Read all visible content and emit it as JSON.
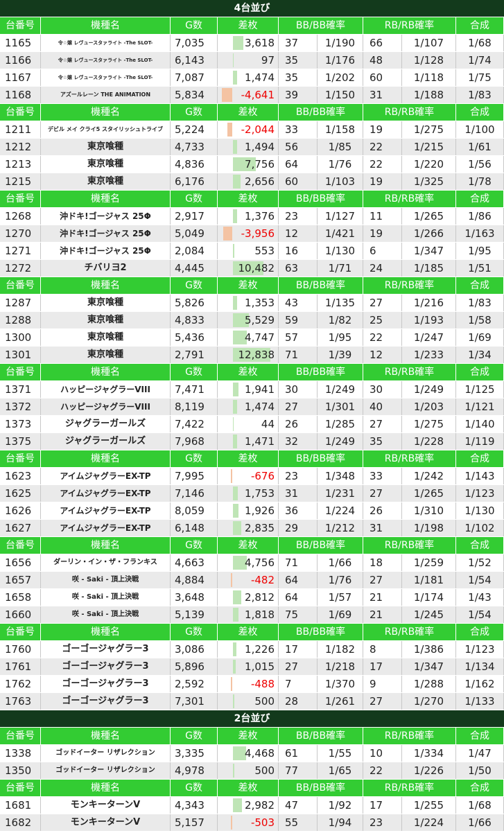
{
  "headers": [
    "台番号",
    "機種名",
    "G数",
    "差枚",
    "BB/BB確率",
    "",
    "RB/RB確率",
    "",
    "合成"
  ],
  "sections": [
    {
      "title": "4台並び",
      "groups": [
        [
          {
            "no": "1165",
            "name": "令☆嬢 レヴュースタァライト -The SLOT-",
            "g": "7,035",
            "diff": 3618,
            "diff_text": "3,618",
            "bb": "37",
            "bbr": "1/190",
            "rb": "66",
            "rbr": "1/107",
            "tot": "1/68"
          },
          {
            "no": "1166",
            "name": "令☆嬢 レヴュースタァライト -The SLOT-",
            "g": "6,143",
            "diff": 97,
            "diff_text": "97",
            "bb": "35",
            "bbr": "1/176",
            "rb": "48",
            "rbr": "1/128",
            "tot": "1/74"
          },
          {
            "no": "1167",
            "name": "令☆嬢 レヴュースタァライト -The SLOT-",
            "g": "7,087",
            "diff": 1474,
            "diff_text": "1,474",
            "bb": "35",
            "bbr": "1/202",
            "rb": "60",
            "rbr": "1/118",
            "tot": "1/75"
          },
          {
            "no": "1168",
            "name": "アズールレーン THE ANIMATION",
            "g": "5,834",
            "diff": -4641,
            "diff_text": "-4,641",
            "bb": "39",
            "bbr": "1/150",
            "rb": "31",
            "rbr": "1/188",
            "tot": "1/83"
          }
        ],
        [
          {
            "no": "1211",
            "name": "デビル メイ クライ5 スタイリッシュトライブ",
            "g": "5,224",
            "diff": -2044,
            "diff_text": "-2,044",
            "bb": "33",
            "bbr": "1/158",
            "rb": "19",
            "rbr": "1/275",
            "tot": "1/100"
          },
          {
            "no": "1212",
            "name": "東京喰種",
            "g": "4,733",
            "diff": 1494,
            "diff_text": "1,494",
            "bb": "56",
            "bbr": "1/85",
            "rb": "22",
            "rbr": "1/215",
            "tot": "1/61"
          },
          {
            "no": "1213",
            "name": "東京喰種",
            "g": "4,836",
            "diff": 7756,
            "diff_text": "7,756",
            "bb": "64",
            "bbr": "1/76",
            "rb": "22",
            "rbr": "1/220",
            "tot": "1/56"
          },
          {
            "no": "1215",
            "name": "東京喰種",
            "g": "6,176",
            "diff": 2656,
            "diff_text": "2,656",
            "bb": "60",
            "bbr": "1/103",
            "rb": "19",
            "rbr": "1/325",
            "tot": "1/78"
          }
        ],
        [
          {
            "no": "1268",
            "name": "沖ドキ!ゴージャス 25Φ",
            "g": "2,917",
            "diff": 1376,
            "diff_text": "1,376",
            "bb": "23",
            "bbr": "1/127",
            "rb": "11",
            "rbr": "1/265",
            "tot": "1/86"
          },
          {
            "no": "1270",
            "name": "沖ドキ!ゴージャス 25Φ",
            "g": "5,049",
            "diff": -3956,
            "diff_text": "-3,956",
            "bb": "12",
            "bbr": "1/421",
            "rb": "19",
            "rbr": "1/266",
            "tot": "1/163"
          },
          {
            "no": "1271",
            "name": "沖ドキ!ゴージャス 25Φ",
            "g": "2,084",
            "diff": 553,
            "diff_text": "553",
            "bb": "16",
            "bbr": "1/130",
            "rb": "6",
            "rbr": "1/347",
            "tot": "1/95"
          },
          {
            "no": "1272",
            "name": "チバリヨ2",
            "g": "4,445",
            "diff": 10482,
            "diff_text": "10,482",
            "bb": "63",
            "bbr": "1/71",
            "rb": "24",
            "rbr": "1/185",
            "tot": "1/51"
          }
        ],
        [
          {
            "no": "1287",
            "name": "東京喰種",
            "g": "5,826",
            "diff": 1353,
            "diff_text": "1,353",
            "bb": "43",
            "bbr": "1/135",
            "rb": "27",
            "rbr": "1/216",
            "tot": "1/83"
          },
          {
            "no": "1288",
            "name": "東京喰種",
            "g": "4,833",
            "diff": 5529,
            "diff_text": "5,529",
            "bb": "59",
            "bbr": "1/82",
            "rb": "25",
            "rbr": "1/193",
            "tot": "1/58"
          },
          {
            "no": "1300",
            "name": "東京喰種",
            "g": "5,436",
            "diff": 4747,
            "diff_text": "4,747",
            "bb": "57",
            "bbr": "1/95",
            "rb": "22",
            "rbr": "1/247",
            "tot": "1/69"
          },
          {
            "no": "1301",
            "name": "東京喰種",
            "g": "2,791",
            "diff": 12838,
            "diff_text": "12,838",
            "bb": "71",
            "bbr": "1/39",
            "rb": "12",
            "rbr": "1/233",
            "tot": "1/34"
          }
        ],
        [
          {
            "no": "1371",
            "name": "ハッピージャグラーVIII",
            "g": "7,471",
            "diff": 1941,
            "diff_text": "1,941",
            "bb": "30",
            "bbr": "1/249",
            "rb": "30",
            "rbr": "1/249",
            "tot": "1/125"
          },
          {
            "no": "1372",
            "name": "ハッピージャグラーVIII",
            "g": "8,119",
            "diff": 1474,
            "diff_text": "1,474",
            "bb": "27",
            "bbr": "1/301",
            "rb": "40",
            "rbr": "1/203",
            "tot": "1/121"
          },
          {
            "no": "1373",
            "name": "ジャグラーガールズ",
            "g": "7,422",
            "diff": 44,
            "diff_text": "44",
            "bb": "26",
            "bbr": "1/285",
            "rb": "27",
            "rbr": "1/275",
            "tot": "1/140"
          },
          {
            "no": "1375",
            "name": "ジャグラーガールズ",
            "g": "7,968",
            "diff": 1471,
            "diff_text": "1,471",
            "bb": "32",
            "bbr": "1/249",
            "rb": "35",
            "rbr": "1/228",
            "tot": "1/119"
          }
        ],
        [
          {
            "no": "1623",
            "name": "アイムジャグラーEX-TP",
            "g": "7,995",
            "diff": -676,
            "diff_text": "-676",
            "bb": "23",
            "bbr": "1/348",
            "rb": "33",
            "rbr": "1/242",
            "tot": "1/143"
          },
          {
            "no": "1625",
            "name": "アイムジャグラーEX-TP",
            "g": "7,146",
            "diff": 1753,
            "diff_text": "1,753",
            "bb": "31",
            "bbr": "1/231",
            "rb": "27",
            "rbr": "1/265",
            "tot": "1/123"
          },
          {
            "no": "1626",
            "name": "アイムジャグラーEX-TP",
            "g": "8,059",
            "diff": 1926,
            "diff_text": "1,926",
            "bb": "36",
            "bbr": "1/224",
            "rb": "26",
            "rbr": "1/310",
            "tot": "1/130"
          },
          {
            "no": "1627",
            "name": "アイムジャグラーEX-TP",
            "g": "6,148",
            "diff": 2835,
            "diff_text": "2,835",
            "bb": "29",
            "bbr": "1/212",
            "rb": "31",
            "rbr": "1/198",
            "tot": "1/102"
          }
        ],
        [
          {
            "no": "1656",
            "name": "ダーリン・イン・ザ・フランキス",
            "g": "4,663",
            "diff": 4756,
            "diff_text": "4,756",
            "bb": "71",
            "bbr": "1/66",
            "rb": "18",
            "rbr": "1/259",
            "tot": "1/52"
          },
          {
            "no": "1657",
            "name": "咲 - Saki - 頂上決戦",
            "g": "4,884",
            "diff": -482,
            "diff_text": "-482",
            "bb": "64",
            "bbr": "1/76",
            "rb": "27",
            "rbr": "1/181",
            "tot": "1/54"
          },
          {
            "no": "1658",
            "name": "咲 - Saki - 頂上決戦",
            "g": "3,648",
            "diff": 2812,
            "diff_text": "2,812",
            "bb": "64",
            "bbr": "1/57",
            "rb": "21",
            "rbr": "1/174",
            "tot": "1/43"
          },
          {
            "no": "1660",
            "name": "咲 - Saki - 頂上決戦",
            "g": "5,139",
            "diff": 1818,
            "diff_text": "1,818",
            "bb": "75",
            "bbr": "1/69",
            "rb": "21",
            "rbr": "1/245",
            "tot": "1/54"
          }
        ],
        [
          {
            "no": "1760",
            "name": "ゴーゴージャグラー3",
            "g": "3,086",
            "diff": 1226,
            "diff_text": "1,226",
            "bb": "17",
            "bbr": "1/182",
            "rb": "8",
            "rbr": "1/386",
            "tot": "1/123"
          },
          {
            "no": "1761",
            "name": "ゴーゴージャグラー3",
            "g": "5,896",
            "diff": 1015,
            "diff_text": "1,015",
            "bb": "27",
            "bbr": "1/218",
            "rb": "17",
            "rbr": "1/347",
            "tot": "1/134"
          },
          {
            "no": "1762",
            "name": "ゴーゴージャグラー3",
            "g": "2,592",
            "diff": -488,
            "diff_text": "-488",
            "bb": "7",
            "bbr": "1/370",
            "rb": "9",
            "rbr": "1/288",
            "tot": "1/162"
          },
          {
            "no": "1763",
            "name": "ゴーゴージャグラー3",
            "g": "7,301",
            "diff": 500,
            "diff_text": "500",
            "bb": "28",
            "bbr": "1/261",
            "rb": "27",
            "rbr": "1/270",
            "tot": "1/133"
          }
        ]
      ]
    },
    {
      "title": "2台並び",
      "groups": [
        [
          {
            "no": "1338",
            "name": "ゴッドイーター リザレクション",
            "g": "3,335",
            "diff": 4468,
            "diff_text": "4,468",
            "bb": "61",
            "bbr": "1/55",
            "rb": "10",
            "rbr": "1/334",
            "tot": "1/47"
          },
          {
            "no": "1350",
            "name": "ゴッドイーター リザレクション",
            "g": "4,978",
            "diff": 500,
            "diff_text": "500",
            "bb": "77",
            "bbr": "1/65",
            "rb": "22",
            "rbr": "1/226",
            "tot": "1/50"
          }
        ],
        [
          {
            "no": "1681",
            "name": "モンキーターンV",
            "g": "4,343",
            "diff": 2982,
            "diff_text": "2,982",
            "bb": "47",
            "bbr": "1/92",
            "rb": "17",
            "rbr": "1/255",
            "tot": "1/68"
          },
          {
            "no": "1682",
            "name": "モンキーターンV",
            "g": "5,157",
            "diff": -503,
            "diff_text": "-503",
            "bb": "55",
            "bbr": "1/94",
            "rb": "23",
            "rbr": "1/224",
            "tot": "1/66"
          }
        ]
      ]
    }
  ]
}
